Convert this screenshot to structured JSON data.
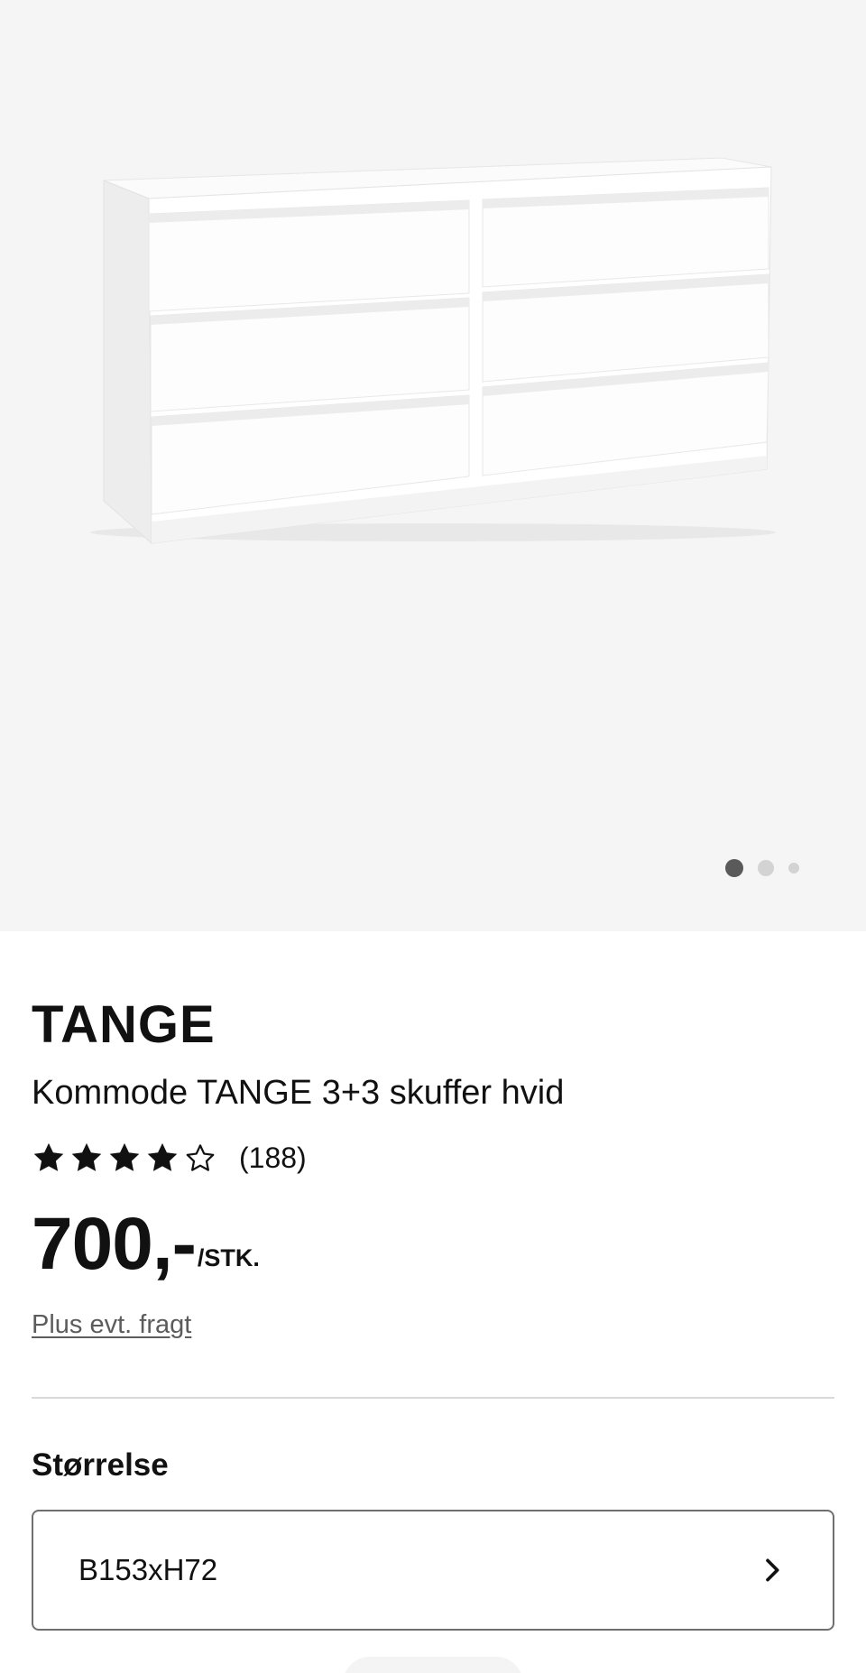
{
  "gallery": {
    "image_alt": "Kommode TANGE 3+3 skuffer hvid",
    "image_count": 3,
    "active_index": 0,
    "background_color": "#f5f5f5"
  },
  "product": {
    "name": "TANGE",
    "description": "Kommode TANGE 3+3 skuffer hvid",
    "rating": 4,
    "rating_max": 5,
    "review_count": "(188)",
    "price": "700,-",
    "price_unit": "/STK.",
    "shipping_link": "Plus evt. fragt"
  },
  "size": {
    "label": "Størrelse",
    "selected": "B153xH72"
  },
  "icons": {
    "star_filled": "star-filled-icon",
    "star_empty": "star-outline-icon",
    "chevron": "chevron-right-icon"
  }
}
